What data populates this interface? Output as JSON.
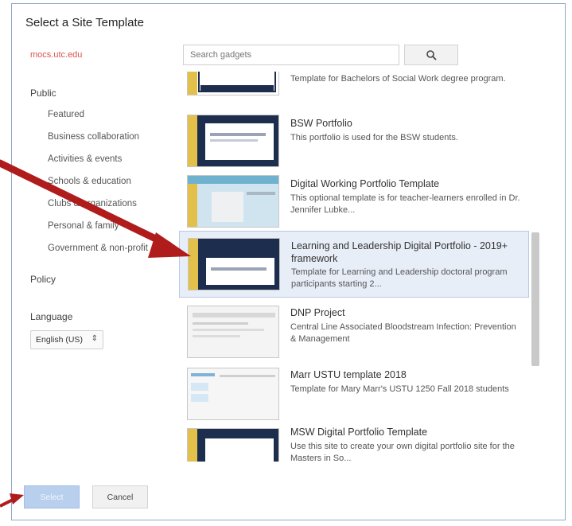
{
  "dialog": {
    "title": "Select a Site Template"
  },
  "domain": "mocs.utc.edu",
  "search": {
    "placeholder": "Search gadgets"
  },
  "sidebar": {
    "public_label": "Public",
    "items": [
      {
        "label": "Featured"
      },
      {
        "label": "Business collaboration"
      },
      {
        "label": "Activities & events"
      },
      {
        "label": "Schools & education"
      },
      {
        "label": "Clubs & organizations"
      },
      {
        "label": "Personal & family"
      },
      {
        "label": "Government & non-profit"
      }
    ],
    "policy_label": "Policy",
    "language_label": "Language",
    "language_value": "English (US)"
  },
  "templates": [
    {
      "title": "",
      "desc": "Template for Bachelors of Social Work degree program."
    },
    {
      "title": "BSW Portfolio",
      "desc": "This portfolio is used for the BSW students."
    },
    {
      "title": "Digital Working Portfolio Template",
      "desc": "This optional template is for teacher-learners enrolled in Dr. Jennifer Lubke..."
    },
    {
      "title": "Learning and Leadership Digital Portfolio - 2019+ framework",
      "desc": "Template for Learning and Leadership doctoral program participants starting 2..."
    },
    {
      "title": "DNP Project",
      "desc": "Central Line Associated Bloodstream Infection: Prevention & Management"
    },
    {
      "title": "Marr USTU template 2018",
      "desc": "Template for Mary Marr's USTU 1250 Fall 2018 students"
    },
    {
      "title": "MSW Digital Portfolio Template",
      "desc": "Use this site to create your own digital portfolio site for the Masters in So..."
    }
  ],
  "buttons": {
    "select": "Select",
    "cancel": "Cancel"
  },
  "colors": {
    "arrow": "#b01c1c",
    "select_button": "#b8cfee",
    "selected_row": "#e8eef8"
  }
}
